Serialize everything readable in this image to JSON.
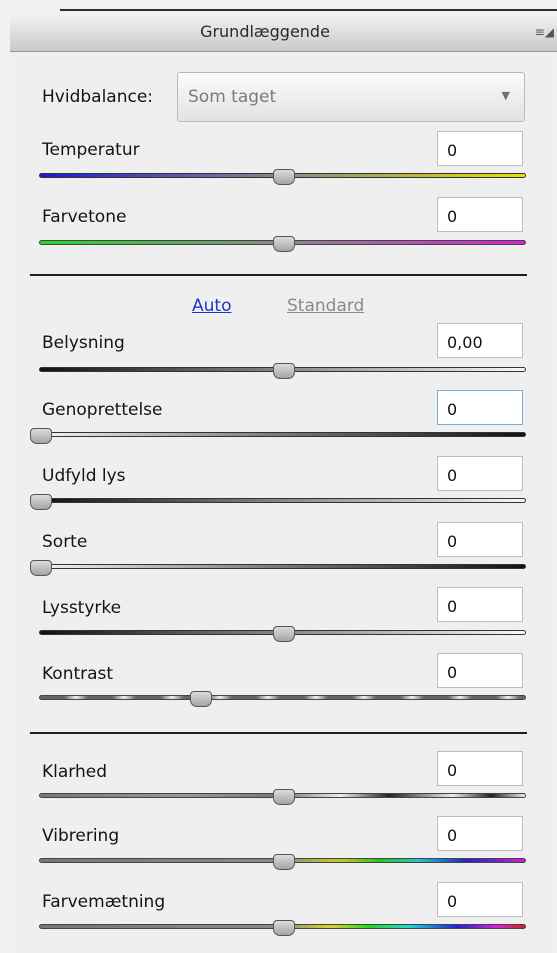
{
  "panel": {
    "title": "Grundlæggende",
    "menu_icon": "panel-menu-icon"
  },
  "white_balance": {
    "label": "Hvidbalance:",
    "value": "Som taget"
  },
  "buttons": {
    "auto": "Auto",
    "standard": "Standard"
  },
  "sliders": [
    {
      "id": "temperature",
      "label": "Temperatur",
      "value": "0",
      "position": 0.5
    },
    {
      "id": "tint",
      "label": "Farvetone",
      "value": "0",
      "position": 0.5
    },
    {
      "id": "exposure",
      "label": "Belysning",
      "value": "0,00",
      "position": 0.5
    },
    {
      "id": "recovery",
      "label": "Genoprettelse",
      "value": "0",
      "position": 0.0
    },
    {
      "id": "fill-light",
      "label": "Udfyld lys",
      "value": "0",
      "position": 0.0
    },
    {
      "id": "blacks",
      "label": "Sorte",
      "value": "0",
      "position": 0.0
    },
    {
      "id": "brightness",
      "label": "Lysstyrke",
      "value": "0",
      "position": 0.5
    },
    {
      "id": "contrast",
      "label": "Kontrast",
      "value": "0",
      "position": 0.33
    },
    {
      "id": "clarity",
      "label": "Klarhed",
      "value": "0",
      "position": 0.5
    },
    {
      "id": "vibrance",
      "label": "Vibrering",
      "value": "0",
      "position": 0.5
    },
    {
      "id": "saturation",
      "label": "Farvemætning",
      "value": "0",
      "position": 0.5
    }
  ]
}
